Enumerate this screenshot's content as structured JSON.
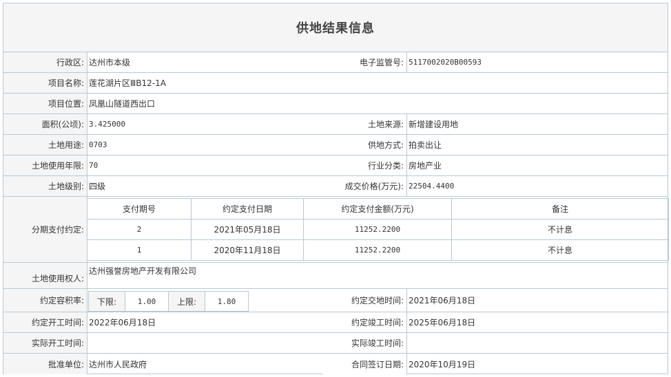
{
  "title": "供地结果信息",
  "fields": {
    "district_label": "行政区:",
    "district": "达州市本级",
    "supervision_label": "电子监管号:",
    "supervision": "5117002020B00593",
    "project_name_label": "项目名称:",
    "project_name": "莲花湖片区ⅢB12-1A",
    "project_location_label": "项目位置:",
    "project_location": "凤凰山隧道西出口",
    "area_label": "面积(公顷):",
    "area": "3.425000",
    "land_source_label": "土地来源:",
    "land_source": "新增建设用地",
    "land_use_label": "土地用途:",
    "land_use": "0703",
    "supply_method_label": "供地方式:",
    "supply_method": "拍卖出让",
    "use_years_label": "土地使用年限:",
    "use_years": "70",
    "industry_label": "行业分类:",
    "industry": "房地产业",
    "land_grade_label": "土地级别:",
    "land_grade": "四级",
    "deal_price_label": "成交价格(万元):",
    "deal_price": "22504.4400",
    "installment_label": "分期支付约定:",
    "land_user_label": "土地使用权人:",
    "land_user": "达州强誉房地产开发有限公司",
    "far_label": "约定容积率:",
    "far_lower_label": "下限:",
    "far_lower": "1.00",
    "far_upper_label": "上限:",
    "far_upper": "1.80",
    "handover_label": "约定交地时间:",
    "handover": "2021年06月18日",
    "start_label": "约定开工时间:",
    "start": "2022年06月18日",
    "finish_label": "约定竣工时间:",
    "finish": "2025年06月18日",
    "actual_start_label": "实际开工时间:",
    "actual_start": "",
    "actual_finish_label": "实际竣工时间:",
    "actual_finish": "",
    "approval_label": "批准单位:",
    "approval": "达州市人民政府",
    "contract_date_label": "合同签订日期:",
    "contract_date": "2020年10月19日"
  },
  "installments": {
    "headers": [
      "支付期号",
      "约定支付日期",
      "约定支付金额(万元)",
      "备注"
    ],
    "rows": [
      {
        "no": "2",
        "date": "2021年05月18日",
        "amount": "11252.2200",
        "note": "不计息"
      },
      {
        "no": "1",
        "date": "2020年11月18日",
        "amount": "11252.2200",
        "note": "不计息"
      }
    ]
  }
}
